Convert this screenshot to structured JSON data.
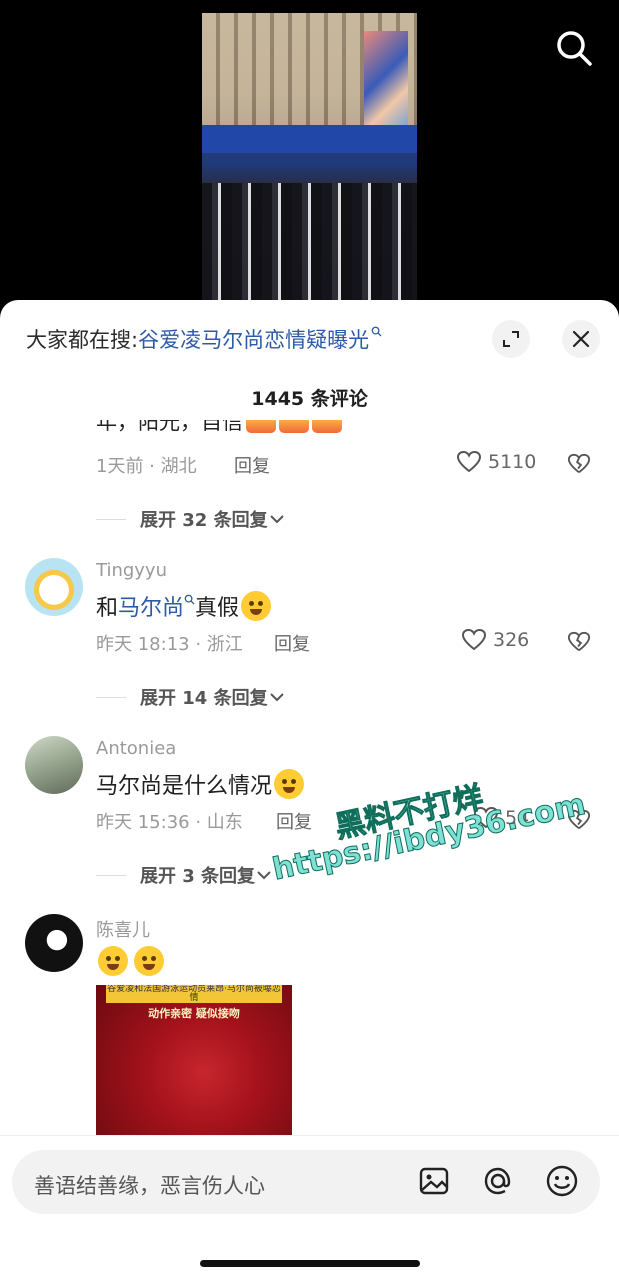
{
  "trending": {
    "prefix": "大家都在搜:",
    "topic": "谷爱凌马尔尚恋情疑曝光"
  },
  "comment_count": "1445 条评论",
  "comments": [
    {
      "partial_text": "年，阳光，自信",
      "meta": "1天前 · 湖北",
      "reply_label": "回复",
      "likes": "5110",
      "expand": "展开 32 条回复"
    },
    {
      "username": "Tingyyu",
      "text_prefix": "和",
      "text_highlight": "马尔尚",
      "text_suffix": "真假",
      "meta": "昨天 18:13 · 浙江",
      "reply_label": "回复",
      "likes": "326",
      "expand": "展开 14 条回复"
    },
    {
      "username": "Antoniea",
      "text": "马尔尚是什么情况",
      "meta": "昨天 15:36 · 山东",
      "reply_label": "回复",
      "likes": "54",
      "expand": "展开 3 条回复"
    },
    {
      "username": "陈喜儿",
      "image_banner": "谷爱凌和法国游泳运动员莱昂·马尔尚被曝恋情",
      "image_caption": "动作亲密 疑似接吻"
    }
  ],
  "watermark": {
    "line1": "黑料不打烊",
    "line2": "https://ibdy36.com"
  },
  "input": {
    "placeholder": "善语结善缘，恶言伤人心"
  },
  "colors": {
    "link": "#2b5ba6",
    "sheet": "#ffffff",
    "background": "#000000"
  },
  "icons": [
    "search-icon",
    "expand-icon",
    "close-icon",
    "heart-icon",
    "broken-heart-icon",
    "chevron-down-icon",
    "image-icon",
    "at-icon",
    "emoji-icon"
  ]
}
